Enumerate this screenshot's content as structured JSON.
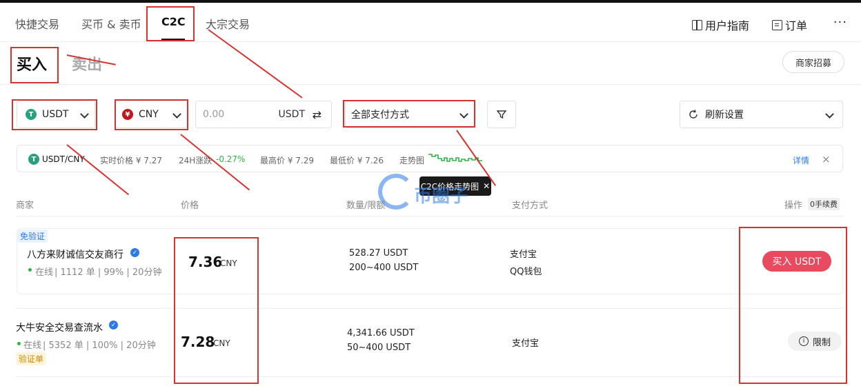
{
  "nav": {
    "tabs": [
      "快捷交易",
      "买币 & 卖币",
      "C2C",
      "大宗交易"
    ],
    "guide": "用户指南",
    "orders": "订单",
    "more": "···"
  },
  "side": {
    "buy": "买入",
    "sell": "卖出"
  },
  "merchant_recruit": "商家招募",
  "filters": {
    "crypto": "USDT",
    "fiat": "CNY",
    "amount_placeholder": "0.00",
    "amount_unit": "USDT",
    "swap_icon": "⇄",
    "payment": "全部支付方式",
    "refresh": "刷新设置"
  },
  "ticker": {
    "pair": "USDT/CNY",
    "price": "实时价格 ¥ 7.27",
    "change_label": "24H涨跌",
    "change_value": "-0.27%",
    "high": "最高价 ¥ 7.29",
    "low": "最低价 ¥ 7.26",
    "trend": "走势图",
    "detail": "详情",
    "close": "×"
  },
  "tooltip": {
    "text": "C2C价格走势图",
    "close": "✕"
  },
  "watermark": "币圈子",
  "columns": {
    "merchant": "商家",
    "price": "价格",
    "amount": "数量/限额",
    "payment": "支付方式",
    "action": "操作",
    "fee": "0手续费"
  },
  "rows": [
    {
      "tag": "免验证",
      "name": "八方来财诚信交友商行",
      "stats_status": "在线",
      "stats_rest": "| 1112 单 | 99% | 20分钟",
      "price": "7.36",
      "currency": "CNY",
      "amount": "528.27 USDT",
      "limit": "200~400 USDT",
      "payments": [
        "支付宝",
        "QQ钱包"
      ],
      "action": "买入 USDT"
    },
    {
      "tag": "验证单",
      "name": "大牛安全交易查流水",
      "stats_status": "在线",
      "stats_rest": "| 5352 单 | 100% | 20分钟",
      "price": "7.28",
      "currency": "CNY",
      "amount": "4,341.66 USDT",
      "limit": "50~400 USDT",
      "payments": [
        "支付宝"
      ],
      "action": "限制"
    }
  ],
  "colors": {
    "accent": "#e84a5f",
    "annotation": "#d6322f",
    "online": "#2fb344",
    "change": "#2fb344",
    "usdt": "#26a17b",
    "cny": "#c4161c",
    "verified": "#2c7be5"
  }
}
